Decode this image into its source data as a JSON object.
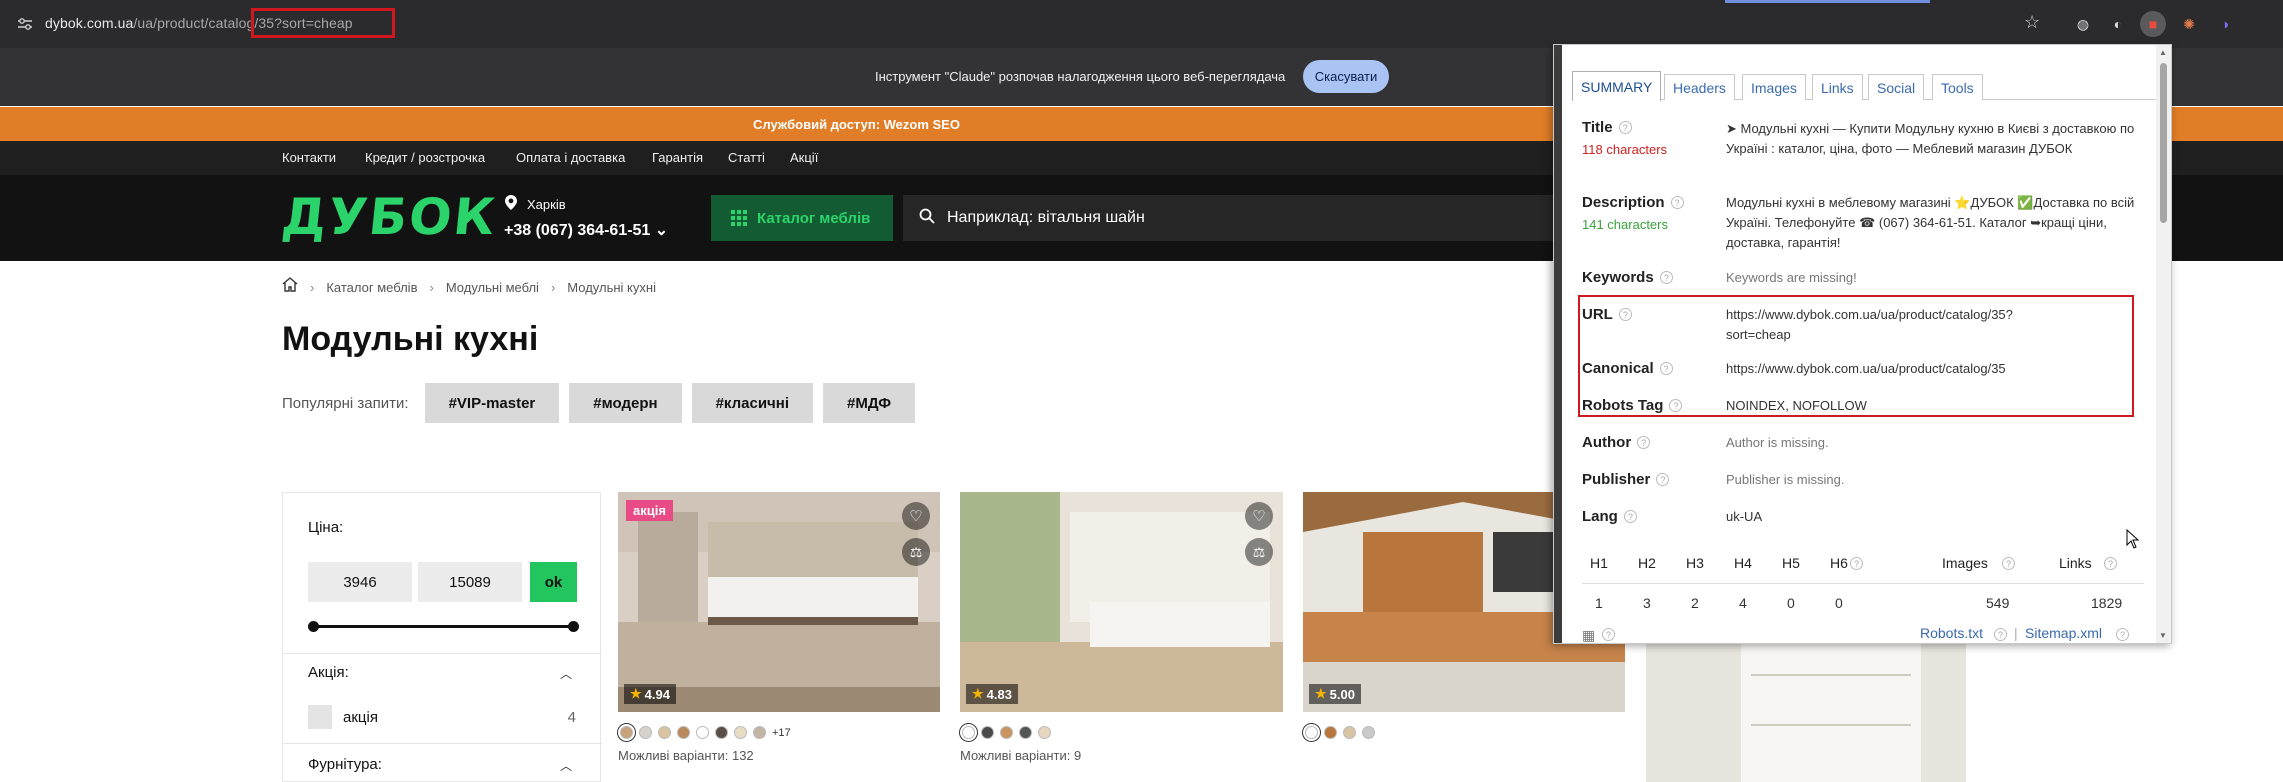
{
  "browser": {
    "url_domain": "dybok.com.ua",
    "url_path": "/ua/product/catalog/35?sort=cheap",
    "extensions": [
      "globe-icon",
      "moon-icon",
      "seo-extension-icon",
      "claude-icon",
      "duo-icon"
    ],
    "colors": {
      "chrome_bg": "#2b2b2d",
      "highlight": "#d0181e"
    }
  },
  "claude_banner": {
    "text": "Інструмент \"Claude\" розпочав налагодження цього веб-переглядача",
    "cancel_label": "Скасувати"
  },
  "service_bar": {
    "text": "Службовий доступ: Wezom SEO"
  },
  "topnav": {
    "items": [
      "Контакти",
      "Кредит / розстрочка",
      "Оплата і доставка",
      "Гарантія",
      "Статті",
      "Акції"
    ]
  },
  "header": {
    "logo": "ДУБОК",
    "city": "Харків",
    "phone": "+38 (067) 364-61-51 ⌄",
    "catalog_label": "Каталог меблів",
    "search_placeholder": "Наприклад: вітальня шайн"
  },
  "breadcrumb": [
    "Каталог меблів",
    "Модульні меблі",
    "Модульні кухні"
  ],
  "page_title": "Модульні кухні",
  "popular": {
    "label": "Популярні запити:",
    "tags": [
      "#VIP-master",
      "#модерн",
      "#класичні",
      "#МДФ"
    ]
  },
  "filter": {
    "price_label": "Ціна:",
    "price_min": "3946",
    "price_max": "15089",
    "ok_label": "ok",
    "group_sale": "Акція:",
    "sale_option": "акція",
    "sale_count": "4",
    "group_hardware": "Фурнітура:"
  },
  "products": [
    {
      "badge": "акція",
      "rating": "4.94",
      "extra_colors": "+17",
      "variants": "Можливі варіанти: 132"
    },
    {
      "badge": "",
      "rating": "4.83",
      "extra_colors": "",
      "variants": "Можливі варіанти: 9"
    },
    {
      "badge": "",
      "rating": "5.00",
      "extra_colors": "",
      "variants": ""
    }
  ],
  "seo": {
    "tabs": [
      "SUMMARY",
      "Headers",
      "Images",
      "Links",
      "Social",
      "Tools"
    ],
    "title_label": "Title",
    "title_chars": "118 characters",
    "title_value": "➤ Модульні кухні — Купити Модульну кухню в Києві з доставкою по Україні : каталог, ціна, фото — Меблевий магазин ДУБОК",
    "description_label": "Description",
    "description_chars": "141 characters",
    "description_value": "Модульні кухні в меблевому магазині ⭐ДУБОК ✅Доставка по всій Україні. Телефонуйте ☎ (067) 364-61-51. Каталог ➥кращі ціни, доставка, гарантія!",
    "keywords_label": "Keywords",
    "keywords_value": "Keywords are missing!",
    "url_label": "URL",
    "url_value": "https://www.dybok.com.ua/ua/product/catalog/35?sort=cheap",
    "canonical_label": "Canonical",
    "canonical_value": "https://www.dybok.com.ua/ua/product/catalog/35",
    "robots_label": "Robots Tag",
    "robots_value": "NOINDEX, NOFOLLOW",
    "author_label": "Author",
    "author_value": "Author is missing.",
    "publisher_label": "Publisher",
    "publisher_value": "Publisher is missing.",
    "lang_label": "Lang",
    "lang_value": "uk-UA",
    "headers": [
      "H1",
      "H2",
      "H3",
      "H4",
      "H5",
      "H6"
    ],
    "header_counts": [
      "1",
      "3",
      "2",
      "4",
      "0",
      "0"
    ],
    "images_label": "Images",
    "images_count": "549",
    "links_label": "Links",
    "links_count": "1829",
    "robots_link": "Robots.txt",
    "sitemap_link": "Sitemap.xml"
  }
}
